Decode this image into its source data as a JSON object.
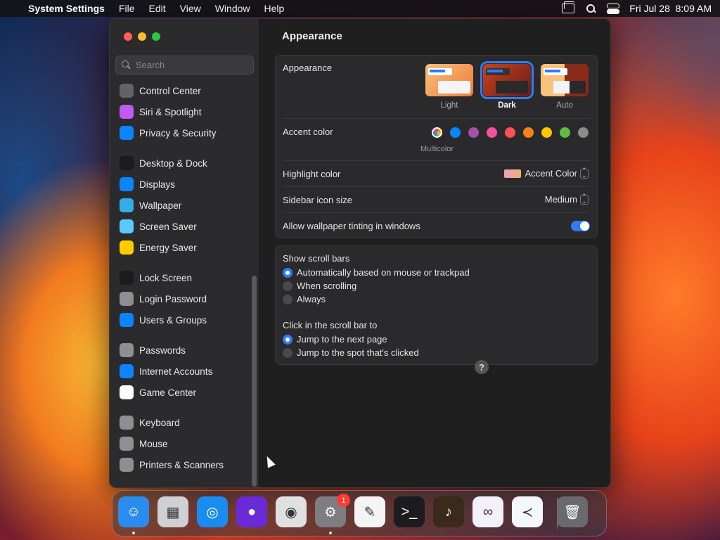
{
  "menubar": {
    "app_name": "System Settings",
    "items": [
      "File",
      "Edit",
      "View",
      "Window",
      "Help"
    ],
    "clock": "Fri Jul 28  8:09 AM"
  },
  "sidebar": {
    "search_placeholder": "Search",
    "items": [
      {
        "label": "Control Center",
        "icon": "control-center-icon",
        "color": "#636366"
      },
      {
        "label": "Siri & Spotlight",
        "icon": "siri-icon",
        "color": "#bf5af2"
      },
      {
        "label": "Privacy & Security",
        "icon": "hand-icon",
        "color": "#0a84ff"
      },
      {
        "label": "Desktop & Dock",
        "icon": "dock-icon",
        "color": "#1c1c1e"
      },
      {
        "label": "Displays",
        "icon": "sun-icon",
        "color": "#0a84ff"
      },
      {
        "label": "Wallpaper",
        "icon": "flower-icon",
        "color": "#32ade6"
      },
      {
        "label": "Screen Saver",
        "icon": "screen-saver-icon",
        "color": "#5ac8fa"
      },
      {
        "label": "Energy Saver",
        "icon": "bulb-icon",
        "color": "#ffcc00"
      },
      {
        "label": "Lock Screen",
        "icon": "lock-icon",
        "color": "#1c1c1e"
      },
      {
        "label": "Login Password",
        "icon": "lock-icon",
        "color": "#8e8e93"
      },
      {
        "label": "Users & Groups",
        "icon": "users-icon",
        "color": "#0a84ff"
      },
      {
        "label": "Passwords",
        "icon": "key-icon",
        "color": "#8e8e93"
      },
      {
        "label": "Internet Accounts",
        "icon": "at-icon",
        "color": "#0a84ff"
      },
      {
        "label": "Game Center",
        "icon": "game-center-icon",
        "color": "#ffffff"
      },
      {
        "label": "Keyboard",
        "icon": "keyboard-icon",
        "color": "#8e8e93"
      },
      {
        "label": "Mouse",
        "icon": "mouse-icon",
        "color": "#8e8e93"
      },
      {
        "label": "Printers & Scanners",
        "icon": "printer-icon",
        "color": "#8e8e93"
      }
    ]
  },
  "content": {
    "title": "Appearance",
    "appearance": {
      "label": "Appearance",
      "options": [
        {
          "label": "Light",
          "selected": false
        },
        {
          "label": "Dark",
          "selected": true
        },
        {
          "label": "Auto",
          "selected": false
        }
      ]
    },
    "accent": {
      "label": "Accent color",
      "selected_label": "Multicolor",
      "colors": [
        "multicolor",
        "#0a84ff",
        "#a550a7",
        "#f74f9e",
        "#ff5257",
        "#f7821b",
        "#ffc600",
        "#62ba46",
        "#8c8c8c"
      ]
    },
    "highlight": {
      "label": "Highlight color",
      "value": "Accent Color"
    },
    "icon_size": {
      "label": "Sidebar icon size",
      "value": "Medium"
    },
    "tinting": {
      "label": "Allow wallpaper tinting in windows",
      "on": true
    },
    "scroll_bars": {
      "label": "Show scroll bars",
      "options": [
        {
          "label": "Automatically based on mouse or trackpad",
          "selected": true
        },
        {
          "label": "When scrolling",
          "selected": false
        },
        {
          "label": "Always",
          "selected": false
        }
      ]
    },
    "click_scroll": {
      "label": "Click in the scroll bar to",
      "options": [
        {
          "label": "Jump to the next page",
          "selected": true
        },
        {
          "label": "Jump to the spot that's clicked",
          "selected": false
        }
      ]
    },
    "help": "?"
  },
  "dock": {
    "apps": [
      {
        "name": "finder-icon",
        "glyph": "☺",
        "color": "#2b8cf0"
      },
      {
        "name": "launchpad-icon",
        "glyph": "▦",
        "color": "#cfcfd4"
      },
      {
        "name": "safari-icon",
        "glyph": "◎",
        "color": "#1a8cf0"
      },
      {
        "name": "firefox-icon",
        "glyph": "●",
        "color": "#6a2ad8"
      },
      {
        "name": "chrome-icon",
        "glyph": "◉",
        "color": "#e0e0e0"
      },
      {
        "name": "system-settings-icon",
        "glyph": "⚙",
        "color": "#7d7d82"
      },
      {
        "name": "textedit-icon",
        "glyph": "✎",
        "color": "#f4f4f4"
      },
      {
        "name": "terminal-icon",
        "glyph": ">_",
        "color": "#1c1c1e"
      },
      {
        "name": "garageband-icon",
        "glyph": "♪",
        "color": "#3a2a1a"
      },
      {
        "name": "visual-studio-icon",
        "glyph": "∞",
        "color": "#f4f0fa"
      },
      {
        "name": "vscode-icon",
        "glyph": "≺",
        "color": "#f4f8fc"
      },
      {
        "name": "trash-icon",
        "glyph": "🗑",
        "color": "#6a6a6e"
      }
    ],
    "settings_badge": "1"
  }
}
